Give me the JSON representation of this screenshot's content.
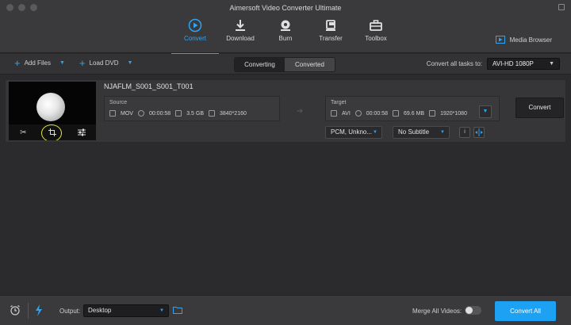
{
  "window": {
    "title": "Aimersoft Video Converter Ultimate"
  },
  "toolbar": {
    "tabs": [
      {
        "label": "Convert",
        "icon": "convert-icon",
        "active": true
      },
      {
        "label": "Download",
        "icon": "download-icon",
        "active": false
      },
      {
        "label": "Burn",
        "icon": "burn-icon",
        "active": false
      },
      {
        "label": "Transfer",
        "icon": "transfer-icon",
        "active": false
      },
      {
        "label": "Toolbox",
        "icon": "toolbox-icon",
        "active": false
      }
    ],
    "media_browser": "Media Browser"
  },
  "subbar": {
    "add_files": "Add Files",
    "load_dvd": "Load DVD",
    "segments": [
      "Converting",
      "Converted"
    ],
    "active_segment": "Converting",
    "convert_all_to_label": "Convert all tasks to:",
    "convert_all_to_value": "AVI-HD 1080P"
  },
  "item": {
    "filename": "NJAFLM_S001_S001_T001",
    "source": {
      "header": "Source",
      "format": "MOV",
      "duration": "00:00:58",
      "size": "3.5 GB",
      "resolution": "3840*2160"
    },
    "target": {
      "header": "Target",
      "format": "AVI",
      "duration": "00:00:58",
      "size": "69.6 MB",
      "resolution": "1920*1080"
    },
    "audio": "PCM, Unkno...",
    "subtitle": "No Subtitle",
    "convert_button": "Convert",
    "info_glyph": "i"
  },
  "bottom": {
    "output_label": "Output:",
    "output_value": "Desktop",
    "merge_label": "Merge All Videos:",
    "merge_enabled": false,
    "convert_all": "Convert All"
  },
  "colors": {
    "accent": "#1da1f2",
    "highlight_circle": "#e6e646"
  }
}
